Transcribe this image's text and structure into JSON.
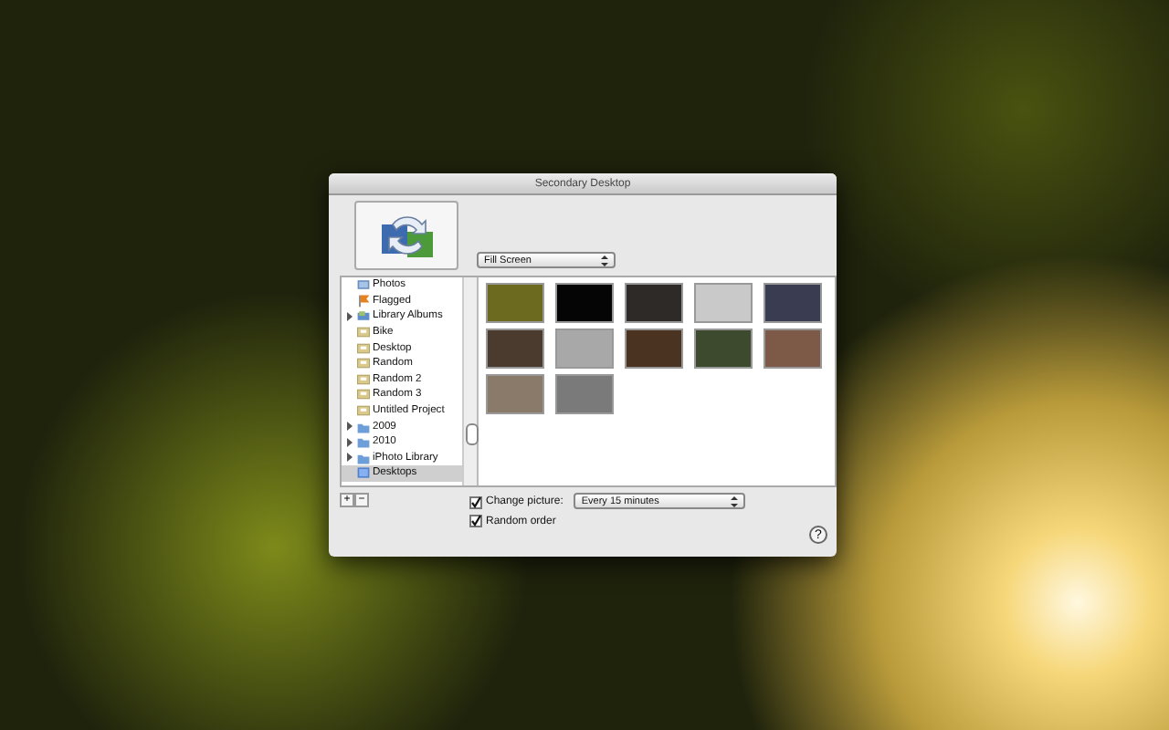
{
  "window": {
    "title": "Secondary Desktop"
  },
  "scaling_popup": {
    "value": "Fill Screen"
  },
  "sidebar": {
    "items": [
      {
        "label": "Photos",
        "kind": "photos",
        "selected": false
      },
      {
        "label": "Flagged",
        "kind": "flag",
        "selected": false
      },
      {
        "label": "Library Albums",
        "kind": "library",
        "selected": false,
        "expanded": false
      },
      {
        "label": "Bike",
        "kind": "album",
        "selected": false
      },
      {
        "label": "Desktop",
        "kind": "album",
        "selected": false
      },
      {
        "label": "Random",
        "kind": "album",
        "selected": false
      },
      {
        "label": "Random 2",
        "kind": "album",
        "selected": false
      },
      {
        "label": "Random 3",
        "kind": "album",
        "selected": false
      },
      {
        "label": "Untitled Project",
        "kind": "album",
        "selected": false
      },
      {
        "label": "2009",
        "kind": "folder",
        "selected": false,
        "expanded": false
      },
      {
        "label": "2010",
        "kind": "folder",
        "selected": false,
        "expanded": false
      },
      {
        "label": "iPhoto Library",
        "kind": "folder",
        "selected": false,
        "expanded": false
      },
      {
        "label": "Desktops",
        "kind": "desktops",
        "selected": true
      }
    ]
  },
  "thumbnails": [
    {
      "kind": "photo"
    },
    {
      "kind": "photo"
    },
    {
      "kind": "photo"
    },
    {
      "kind": "photo"
    },
    {
      "kind": "photo"
    },
    {
      "kind": "photo"
    },
    {
      "kind": "photo"
    },
    {
      "kind": "photo"
    },
    {
      "kind": "photo"
    },
    {
      "kind": "photo"
    },
    {
      "kind": "photo"
    },
    {
      "kind": "photo"
    }
  ],
  "list_buttons": [
    "+",
    "−"
  ],
  "options": [
    {
      "kind": "interval",
      "label": "Change picture:",
      "checked": true,
      "value": "Every 15 minutes"
    },
    {
      "kind": "plain",
      "label": "Random order",
      "checked": true
    }
  ],
  "help_button": "?"
}
